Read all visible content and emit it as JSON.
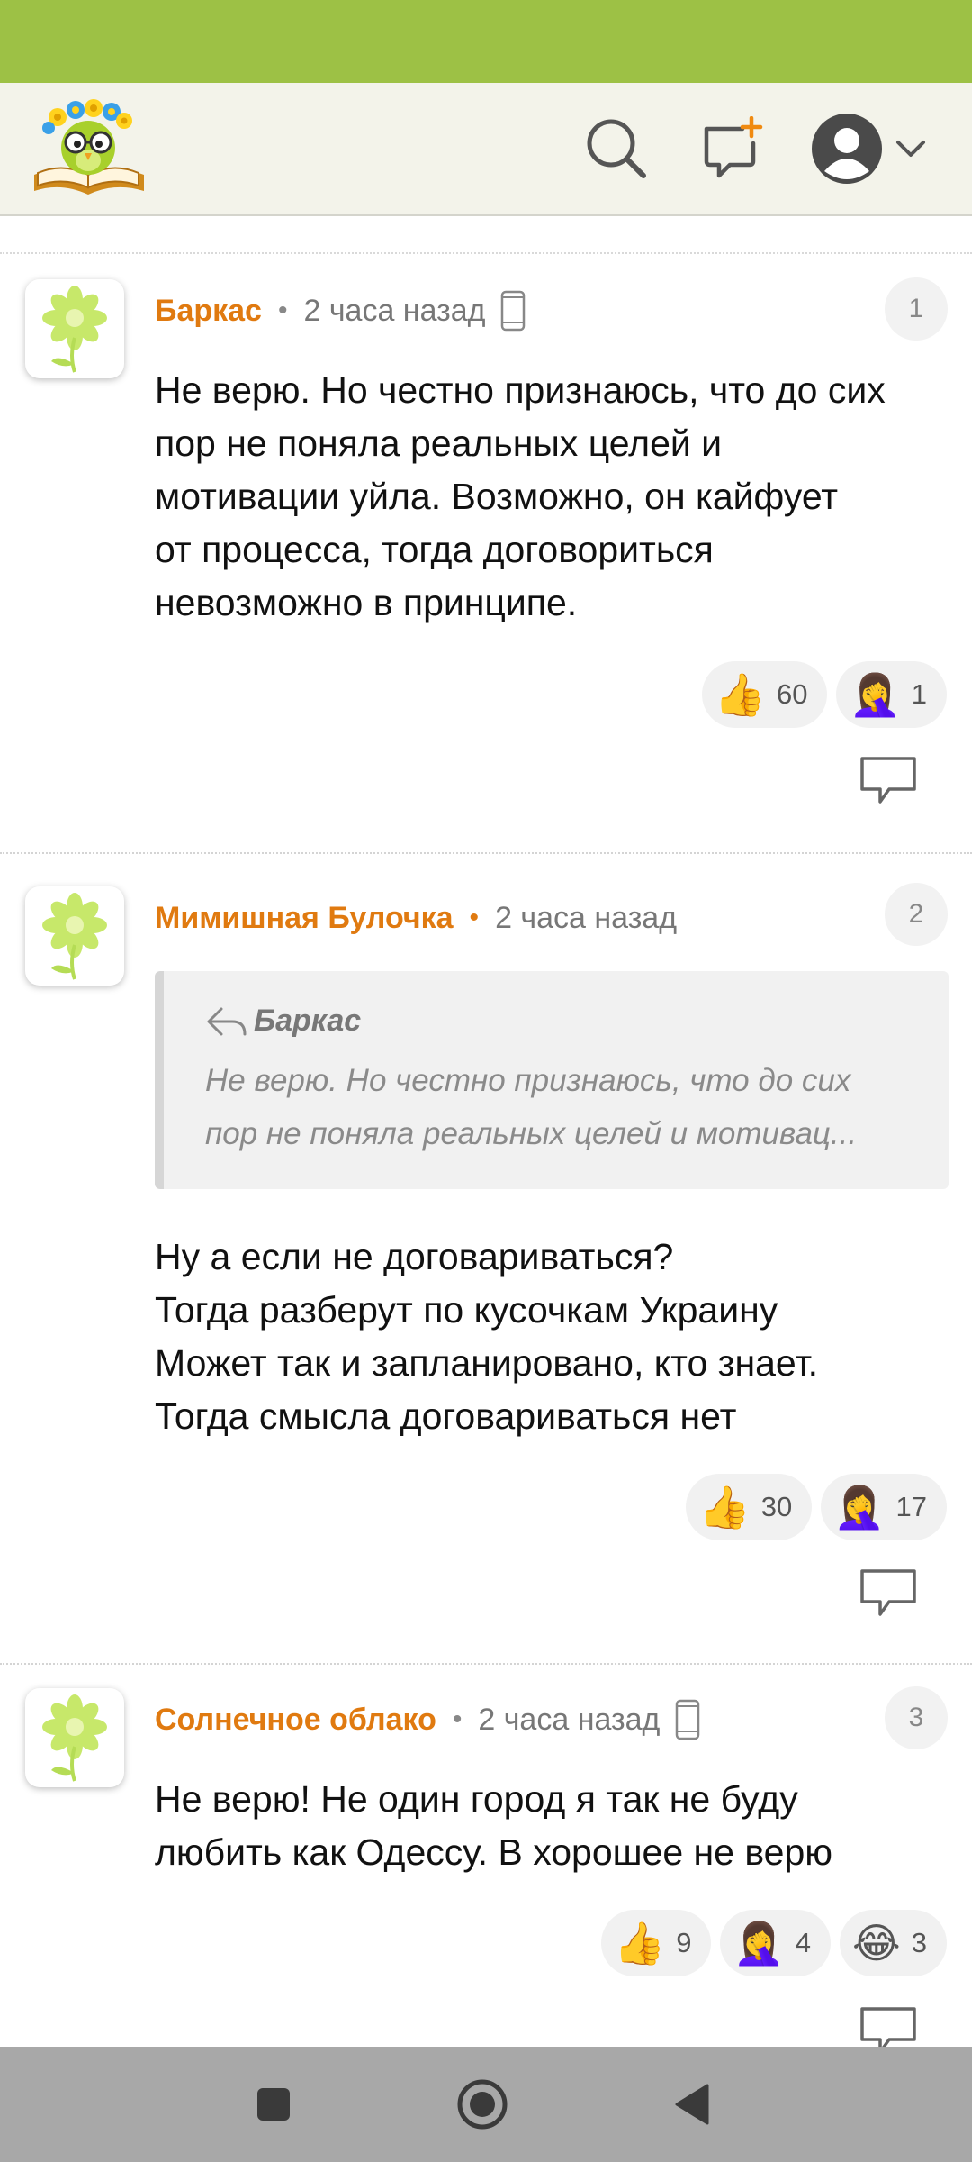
{
  "header": {
    "logo_icon": "book-owl-flowers-logo",
    "icons": [
      "search-icon",
      "new-post-icon",
      "avatar-icon",
      "chevron-down-icon"
    ]
  },
  "comments": [
    {
      "author": "Баркас",
      "time": "2 часа назад",
      "number": "1",
      "lines": [
        "Не верю. Но честно признаюсь, что до сих",
        "пор не поняла реальных целей и",
        "мотивации уйла. Возможно, он кайфует",
        "от процесса, тогда договориться",
        "невозможно в принципе."
      ],
      "reactions": [
        {
          "emoji": "👍",
          "count": "60"
        },
        {
          "emoji": "🤦‍♀️",
          "count": "1"
        }
      ]
    },
    {
      "author": "Мимишная Булочка",
      "time": "2 часа назад",
      "number": "2",
      "quote": {
        "author": "Баркас",
        "lines": [
          "Не верю. Но честно признаюсь, что до сих",
          "пор не поняла реальных целей и мотивац..."
        ]
      },
      "lines": [
        "Ну а если не договариваться?",
        "Тогда разберут по кусочкам Украину",
        "Может так и запланировано, кто знает.",
        "Тогда смысла договариваться нет"
      ],
      "reactions": [
        {
          "emoji": "👍",
          "count": "30"
        },
        {
          "emoji": "🤦‍♀️",
          "count": "17"
        }
      ]
    },
    {
      "author": "Солнечное облако",
      "time": "2 часа назад",
      "number": "3",
      "lines": [
        "Не верю! Не один город я так не буду",
        "любить как Одессу. В хорошее не верю"
      ],
      "reactions": [
        {
          "emoji": "👍",
          "count": "9"
        },
        {
          "emoji": "🤦‍♀️",
          "count": "4"
        },
        {
          "emoji": "😂",
          "count": "3"
        }
      ]
    }
  ],
  "colors": {
    "status_bar": "#9dc145",
    "author": "#e07a10",
    "header_bg": "#f3f3ea",
    "nav_bar": "#a8a8a8"
  }
}
